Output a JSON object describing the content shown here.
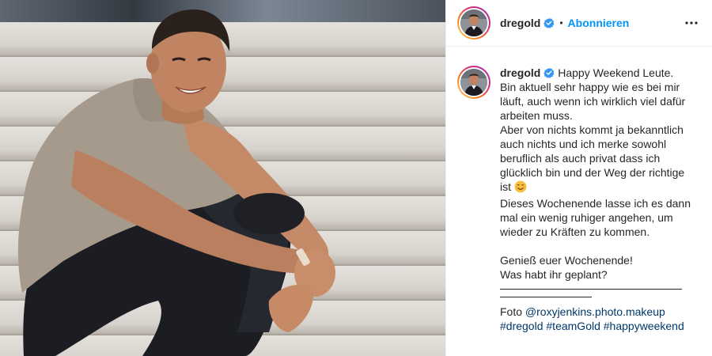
{
  "account": {
    "username": "dregold",
    "separator": "•",
    "follow_label": "Abonnieren"
  },
  "caption": {
    "username": "dregold",
    "line1": "Happy Weekend Leute.",
    "para1": "Bin aktuell sehr happy wie es bei mir läuft, auch wenn ich wirklich viel dafür arbeiten muss.",
    "para2": "Aber von nichts kommt ja bekanntlich auch nichts und ich merke sowohl beruflich als auch privat dass ich glücklich bin und der Weg der richtige ist",
    "para3": "Dieses Wochenende lasse ich es dann mal ein wenig ruhiger angehen, um wieder zu Kräften zu kommen.",
    "para4": "Genieß euer Wochenende!",
    "para5": "Was habt ihr geplant?",
    "credit_prefix": "Foto",
    "credit_handle": "@roxyjenkins.photo.makeup",
    "hashtags": [
      "#dregold",
      "#teamGold",
      "#happyweekend"
    ]
  },
  "icons": {
    "verified": "verified-badge-icon",
    "more": "more-options-icon",
    "emoji": "smiling-face-emoji"
  },
  "colors": {
    "accent": "#0095f6",
    "link": "#00376b",
    "text": "#262626",
    "verified": "#3897f0"
  }
}
